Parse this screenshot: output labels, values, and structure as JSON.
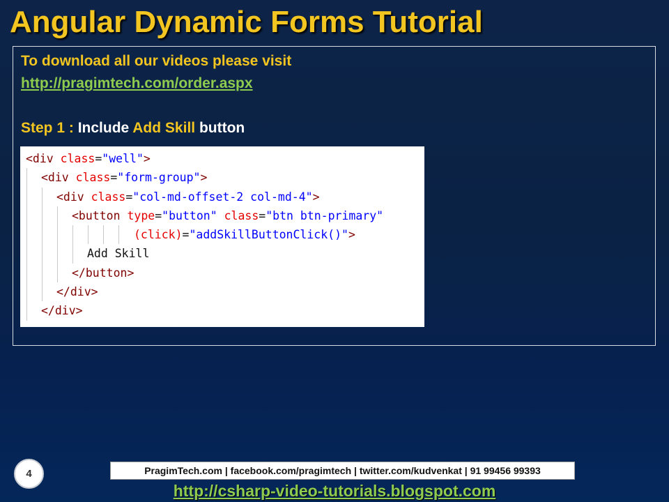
{
  "slide": {
    "title": "Angular Dynamic Forms Tutorial",
    "intro_text": "To download all our videos please visit",
    "download_link": "http://pragimtech.com/order.aspx",
    "step": {
      "label": "Step 1 :",
      "text_before": " Include ",
      "highlight": "Add Skill",
      "text_after": " button"
    }
  },
  "code": {
    "lines": [
      {
        "t1": "<div ",
        "a1": "class",
        "e1": "=",
        "s1": "\"well\"",
        "t2": ">",
        "a2": "",
        "e2": "",
        "s2": "",
        "t3": ""
      },
      {
        "t1": "<div ",
        "a1": "class",
        "e1": "=",
        "s1": "\"form-group\"",
        "t2": ">",
        "a2": "",
        "e2": "",
        "s2": "",
        "t3": ""
      },
      {
        "t1": "<div ",
        "a1": "class",
        "e1": "=",
        "s1": "\"col-md-offset-2 col-md-4\"",
        "t2": ">",
        "a2": "",
        "e2": "",
        "s2": "",
        "t3": ""
      },
      {
        "t1": "<button ",
        "a1": "type",
        "e1": "=",
        "s1": "\"button\"",
        "t2": " ",
        "a2": "class",
        "e2": "=",
        "s2": "\"btn btn-primary\"",
        "t3": ""
      },
      {
        "t1": "",
        "a1": "(click)",
        "e1": "=",
        "s1": "\"addSkillButtonClick()\"",
        "t2": ">",
        "a2": "",
        "e2": "",
        "s2": "",
        "t3": ""
      },
      {
        "t1": "Add Skill",
        "a1": "",
        "e1": "",
        "s1": "",
        "t2": "",
        "a2": "",
        "e2": "",
        "s2": "",
        "t3": ""
      },
      {
        "t1": "</button>",
        "a1": "",
        "e1": "",
        "s1": "",
        "t2": "",
        "a2": "",
        "e2": "",
        "s2": "",
        "t3": ""
      },
      {
        "t1": "</div>",
        "a1": "",
        "e1": "",
        "s1": "",
        "t2": "",
        "a2": "",
        "e2": "",
        "s2": "",
        "t3": ""
      },
      {
        "t1": "</div>",
        "a1": "",
        "e1": "",
        "s1": "",
        "t2": "",
        "a2": "",
        "e2": "",
        "s2": "",
        "t3": ""
      }
    ]
  },
  "footer": {
    "page_number": "4",
    "contact": "PragimTech.com | facebook.com/pragimtech | twitter.com/kudvenkat | 91 99456 99393",
    "blog_link": "http://csharp-video-tutorials.blogspot.com"
  }
}
